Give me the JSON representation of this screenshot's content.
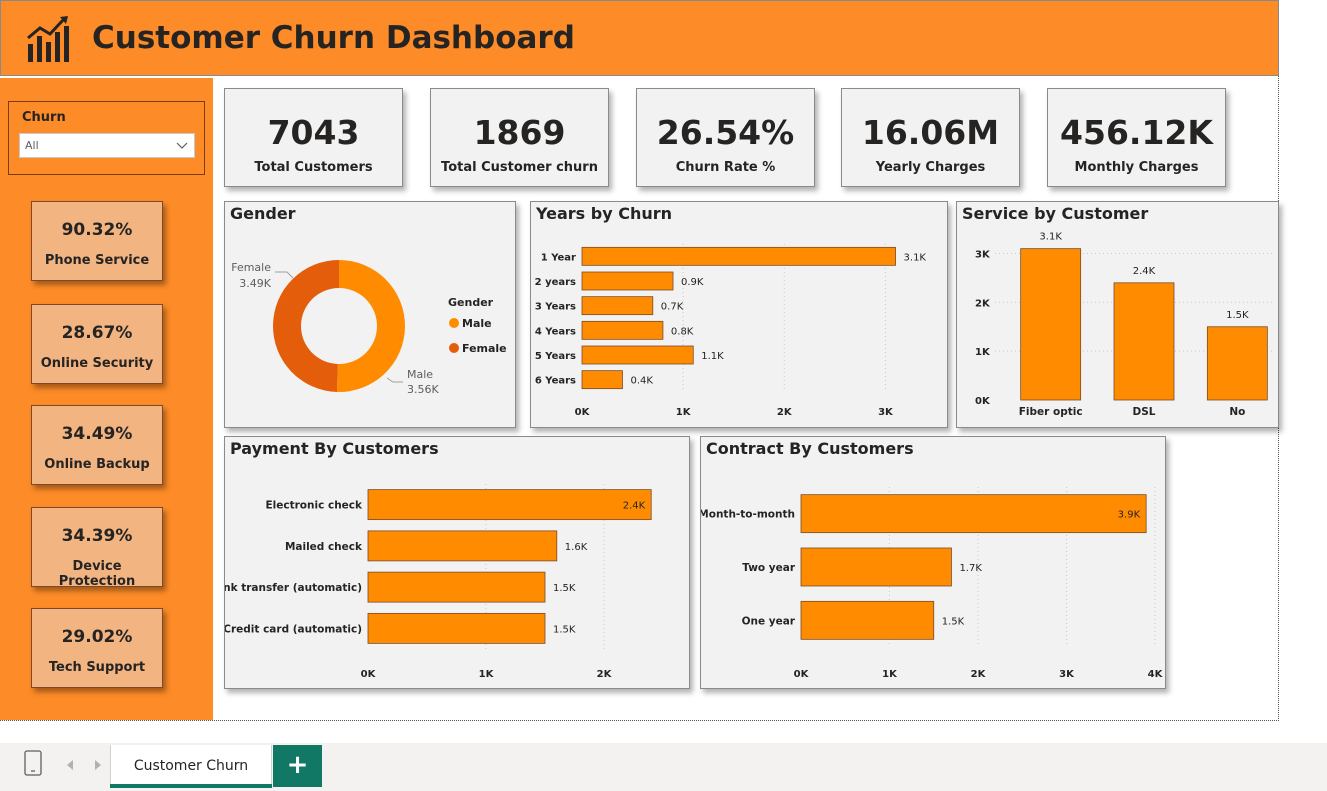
{
  "header": {
    "title": "Customer Churn Dashboard"
  },
  "slicer": {
    "label": "Churn",
    "value": "All"
  },
  "services": [
    {
      "pct": "90.32%",
      "label": "Phone Service"
    },
    {
      "pct": "28.67%",
      "label": "Online Security"
    },
    {
      "pct": "34.49%",
      "label": "Online Backup"
    },
    {
      "pct": "34.39%",
      "label": "Device Protection"
    },
    {
      "pct": "29.02%",
      "label": "Tech Support"
    }
  ],
  "kpis": [
    {
      "value": "7043",
      "label": "Total Customers"
    },
    {
      "value": "1869",
      "label": "Total Customer churn"
    },
    {
      "value": "26.54%",
      "label": "Churn Rate %"
    },
    {
      "value": "16.06M",
      "label": "Yearly Charges"
    },
    {
      "value": "456.12K",
      "label": "Monthly Charges"
    }
  ],
  "colors": {
    "orange": "#fd8b27",
    "bar": "#ff8c00",
    "male": "#ff8c00",
    "female": "#e35d0b",
    "teal": "#117865"
  },
  "chart_data": [
    {
      "id": "gender",
      "type": "pie",
      "title": "Gender",
      "legend_title": "Gender",
      "categories": [
        "Male",
        "Female"
      ],
      "values": [
        3.56,
        3.49
      ],
      "data_labels": [
        "3.56K",
        "3.49K"
      ],
      "legend": "right"
    },
    {
      "id": "years",
      "type": "bar",
      "title": "Years by Churn",
      "orientation": "horizontal",
      "categories": [
        "1 Year",
        "2 years",
        "3 Years",
        "4 Years",
        "5 Years",
        "6 Years"
      ],
      "values": [
        3.1,
        0.9,
        0.7,
        0.8,
        1.1,
        0.4
      ],
      "data_labels": [
        "3.1K",
        "0.9K",
        "0.7K",
        "0.8K",
        "1.1K",
        "0.4K"
      ],
      "xticks": [
        "0K",
        "1K",
        "2K",
        "3K"
      ],
      "xlim": [
        0,
        3.5
      ]
    },
    {
      "id": "service",
      "type": "bar",
      "title": "Service by Customer",
      "orientation": "vertical",
      "categories": [
        "Fiber optic",
        "DSL",
        "No"
      ],
      "values": [
        3.1,
        2.4,
        1.5
      ],
      "data_labels": [
        "3.1K",
        "2.4K",
        "1.5K"
      ],
      "yticks": [
        "0K",
        "1K",
        "2K",
        "3K"
      ],
      "ylim": [
        0,
        3.4
      ]
    },
    {
      "id": "payment",
      "type": "bar",
      "title": "Payment By Customers",
      "orientation": "horizontal",
      "categories": [
        "Electronic check",
        "Mailed check",
        "Bank transfer (automatic)",
        "Credit card (automatic)"
      ],
      "values": [
        2.4,
        1.6,
        1.5,
        1.5
      ],
      "data_labels": [
        "2.4K",
        "1.6K",
        "1.5K",
        "1.5K"
      ],
      "xticks": [
        "0K",
        "1K",
        "2K"
      ],
      "xlim": [
        0,
        2.5
      ]
    },
    {
      "id": "contract",
      "type": "bar",
      "title": "Contract By Customers",
      "orientation": "horizontal",
      "categories": [
        "Month-to-month",
        "Two year",
        "One year"
      ],
      "values": [
        3.9,
        1.7,
        1.5
      ],
      "data_labels": [
        "3.9K",
        "1.7K",
        "1.5K"
      ],
      "xticks": [
        "0K",
        "1K",
        "2K",
        "3K",
        "4K"
      ],
      "xlim": [
        0,
        4
      ]
    }
  ],
  "tabs": {
    "active": "Customer Churn",
    "add_icon": "+"
  }
}
